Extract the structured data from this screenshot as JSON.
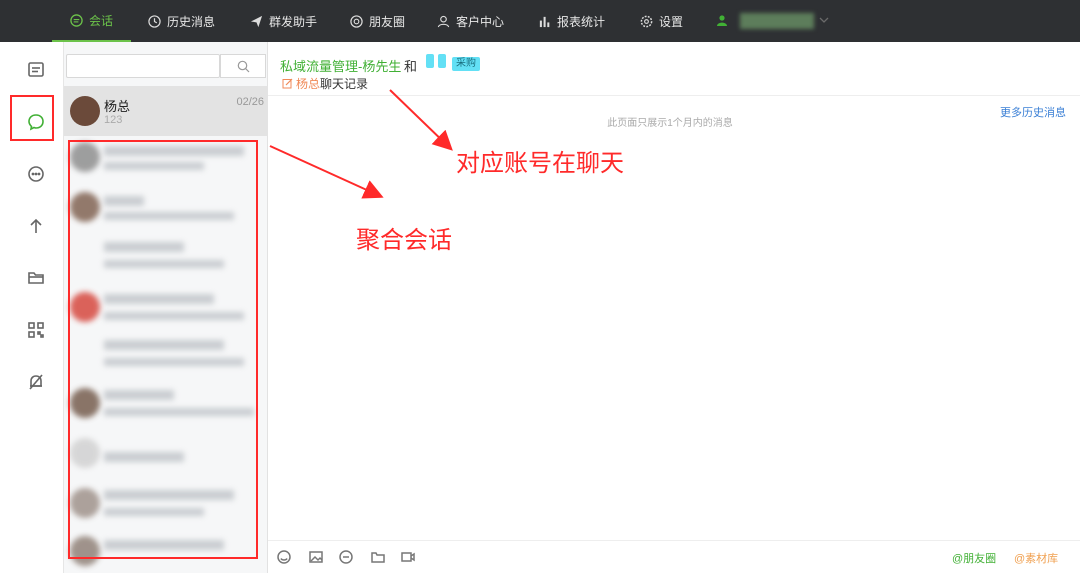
{
  "topnav": {
    "items": [
      {
        "label": "会话",
        "icon": "chat-icon",
        "active": true
      },
      {
        "label": "历史消息",
        "icon": "clock-icon"
      },
      {
        "label": "群发助手",
        "icon": "send-icon"
      },
      {
        "label": "朋友圈",
        "icon": "moments-icon"
      },
      {
        "label": "客户中心",
        "icon": "person-icon"
      },
      {
        "label": "报表统计",
        "icon": "bar-chart-icon"
      },
      {
        "label": "设置",
        "icon": "gear-icon"
      }
    ],
    "accent": "#6cc24a"
  },
  "sidebar": {
    "icons": [
      "notes-icon",
      "chat-bubble-icon",
      "comment-icon",
      "upload-arrow-icon",
      "folder-icon",
      "qrcode-icon",
      "bell-off-icon"
    ],
    "active_index": 1
  },
  "conversations": {
    "search_placeholder": "",
    "items": [
      {
        "name": "杨总",
        "preview": "123",
        "time": "02/26"
      }
    ]
  },
  "chat": {
    "account": "私域流量管理-杨先生",
    "and_text": "和",
    "tag": "采购",
    "record_name": "杨总",
    "record_suffix": "聊天记录",
    "notice": "此页面只展示1个月内的消息",
    "more_history": "更多历史消息",
    "moments_link": "@朋友圈",
    "material_link": "@素材库"
  },
  "annotations": {
    "account_label": "对应账号在聊天",
    "aggregate_label": "聚合会话",
    "color": "#ff2a2a"
  }
}
